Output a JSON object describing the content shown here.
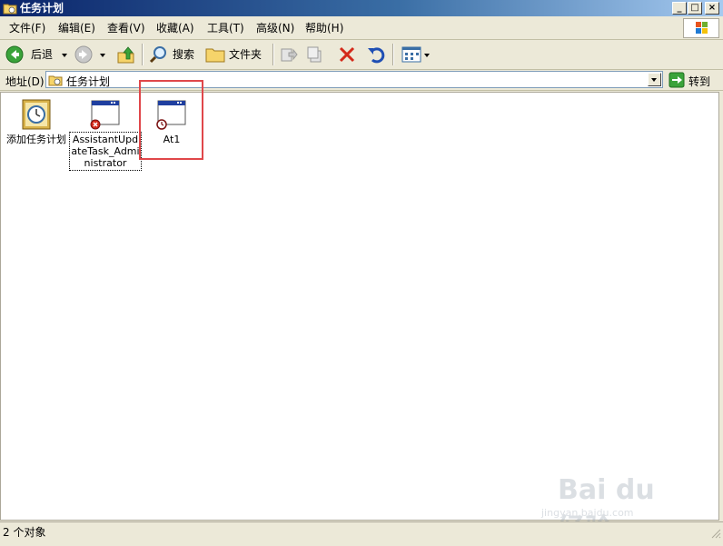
{
  "window": {
    "title": "任务计划",
    "controls": {
      "minimize": "_",
      "maximize": "□",
      "close": "×"
    }
  },
  "menu": [
    "文件(F)",
    "编辑(E)",
    "查看(V)",
    "收藏(A)",
    "工具(T)",
    "高级(N)",
    "帮助(H)"
  ],
  "toolbar": {
    "back_label": "后退",
    "search_label": "搜索",
    "folders_label": "文件夹"
  },
  "address": {
    "label": "地址(D)",
    "value": "任务计划",
    "go_label": "转到"
  },
  "items": [
    {
      "label": "添加任务计划",
      "icon": "add-task-icon"
    },
    {
      "label": "AssistantUpdateTask_Administrator",
      "icon": "task-disabled-icon",
      "selected": true
    },
    {
      "label": "At1",
      "icon": "task-scheduled-icon",
      "highlighted": true
    }
  ],
  "status": {
    "text": "2 个对象"
  },
  "watermark": {
    "main": "Bai du 经验",
    "sub": "jingyan.baidu.com"
  },
  "colors": {
    "titlebar": "#0a246a",
    "highlight": "#e0474a",
    "chrome": "#ece9d8"
  }
}
